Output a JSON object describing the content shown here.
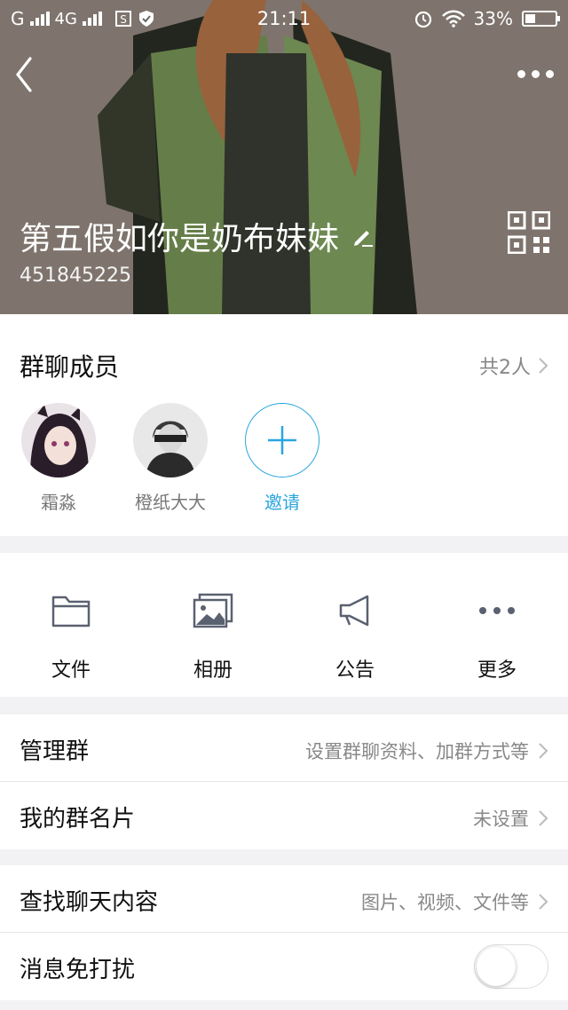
{
  "status_bar": {
    "carrier": "G",
    "network": "4G",
    "time": "21:11",
    "battery": "33%",
    "battery_level": 0.33
  },
  "header": {
    "group_name": "第五假如你是奶布妹妹",
    "group_id": "451845225"
  },
  "members": {
    "title": "群聊成员",
    "count": "共2人",
    "list": [
      {
        "name": "霜淼"
      },
      {
        "name": "橙纸大大"
      }
    ],
    "invite_label": "邀请"
  },
  "tools": {
    "items": [
      {
        "label": "文件",
        "icon": "folder-icon"
      },
      {
        "label": "相册",
        "icon": "album-icon"
      },
      {
        "label": "公告",
        "icon": "megaphone-icon"
      },
      {
        "label": "更多",
        "icon": "more-dots-icon"
      }
    ]
  },
  "settings": {
    "manage": {
      "title": "管理群",
      "value": "设置群聊资料、加群方式等"
    },
    "card": {
      "title": "我的群名片",
      "value": "未设置"
    },
    "search": {
      "title": "查找聊天内容",
      "value": "图片、视频、文件等"
    },
    "dnd": {
      "title": "消息免打扰",
      "enabled": false
    }
  },
  "colors": {
    "accent": "#2aa6df",
    "secondary_text": "#888888",
    "background": "#f2f2f4"
  }
}
